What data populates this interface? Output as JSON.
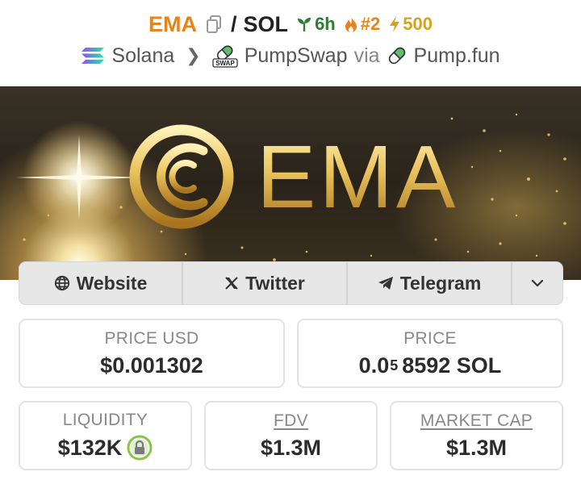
{
  "header": {
    "base_symbol": "EMA",
    "separator": "/",
    "quote_symbol": "SOL",
    "age": "6h",
    "trending_rank": "#2",
    "boosts": "500"
  },
  "chain_row": {
    "chain": "Solana",
    "dex": "PumpSwap",
    "via_label": "via",
    "launchpad": "Pump.fun",
    "dex_badge_text": "SWAP"
  },
  "banner": {
    "logo_text": "EMA"
  },
  "links": {
    "website": "Website",
    "twitter": "Twitter",
    "telegram": "Telegram"
  },
  "stats": {
    "price_usd_label": "PRICE USD",
    "price_usd_value": "$0.001302",
    "price_label": "PRICE",
    "price_prefix": "0.0",
    "price_zero_count": "5",
    "price_rest": "8592 SOL",
    "liquidity_label": "LIQUIDITY",
    "liquidity_value": "$132K",
    "fdv_label": "FDV",
    "fdv_value": "$1.3M",
    "mcap_label": "MARKET CAP",
    "mcap_value": "$1.3M"
  },
  "colors": {
    "base_symbol": "#e8821a",
    "age": "#2e7d32",
    "trending": "#e8821a",
    "boost": "#d4a514",
    "lock_ring": "#8bc34a"
  }
}
